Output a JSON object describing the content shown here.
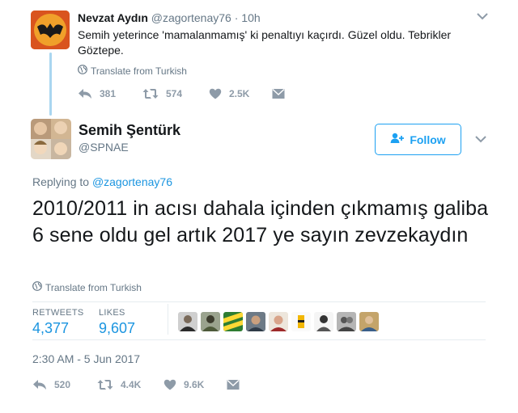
{
  "parent_tweet": {
    "name": "Nevzat Aydın",
    "handle": "@zagortenay76",
    "time": "10h",
    "text": "Semih yeterince 'mamalanmamış' ki penaltıyı kaçırdı. Güzel oldu. Tebrikler Göztepe.",
    "translate": "Translate from Turkish",
    "actions": {
      "reply": "381",
      "retweet": "574",
      "like": "2.5K"
    }
  },
  "main_tweet": {
    "name": "Semih Şentürk",
    "handle": "@SPNAE",
    "follow_label": "Follow",
    "replying_prefix": "Replying to ",
    "replying_to": "@zagortenay76",
    "text": "2010/2011 in acısı dahala içinden çıkmamış galiba 6 sene oldu gel artık 2017 ye sayın zevzekaydın",
    "translate": "Translate from Turkish",
    "stats": {
      "retweets_label": "RETWEETS",
      "retweets_value": "4,377",
      "likes_label": "LIKES",
      "likes_value": "9,607"
    },
    "timestamp": "2:30 AM - 5 Jun 2017",
    "actions": {
      "reply": "520",
      "retweet": "4.4K",
      "like": "9.6K"
    }
  },
  "icons": {
    "reply": "reply-icon",
    "retweet": "retweet-icon",
    "like": "heart-icon",
    "dm": "envelope-icon",
    "more": "chevron-down-icon",
    "globe": "globe-icon",
    "follow": "add-user-icon"
  },
  "colors": {
    "accent": "#1da1f2",
    "link": "#1b95e0",
    "muted": "#657786",
    "thread_line": "#a9d6f0"
  }
}
